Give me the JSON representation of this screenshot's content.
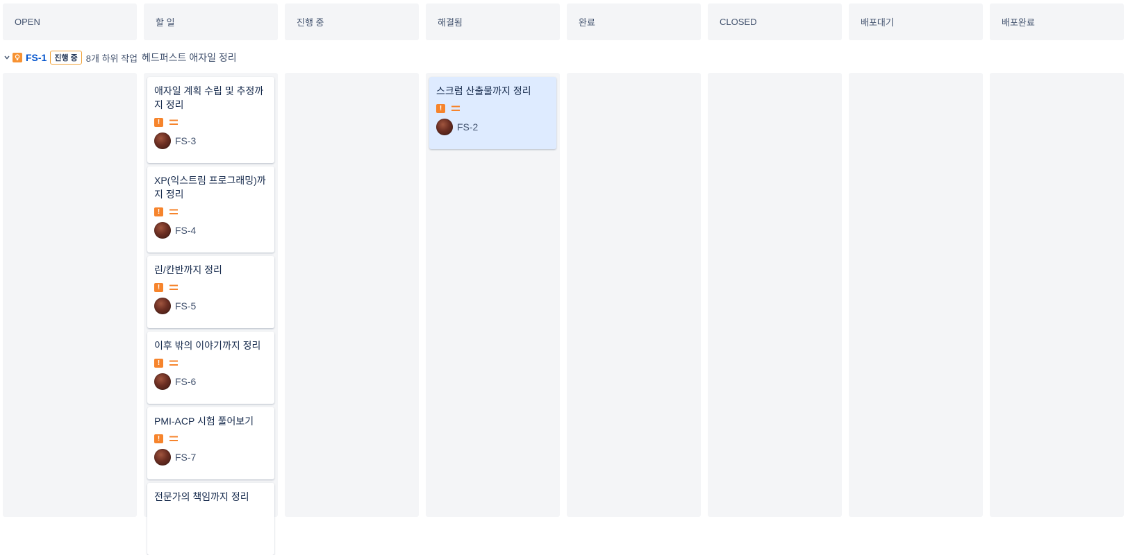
{
  "columns": [
    "OPEN",
    "할 일",
    "진행 중",
    "해결됨",
    "완료",
    "CLOSED",
    "배포대기",
    "배포완료"
  ],
  "epic": {
    "key": "FS-1",
    "status": "진행 중",
    "subtasks": "8개 하위 작업",
    "summary": "헤드퍼스트 애자일 정리",
    "icon": "lightbulb-icon",
    "color": "#f79232"
  },
  "todo_cards": [
    {
      "title": "애자일 계획 수립 및 추정까지 정리",
      "key": "FS-3",
      "priority": "major"
    },
    {
      "title": "XP(익스트림 프로그래밍)까지 정리",
      "key": "FS-4",
      "priority": "major"
    },
    {
      "title": "린/칸반까지 정리",
      "key": "FS-5",
      "priority": "major"
    },
    {
      "title": "이후 밖의 이야기까지 정리",
      "key": "FS-6",
      "priority": "major"
    },
    {
      "title": "PMI-ACP 시험 풀어보기",
      "key": "FS-7",
      "priority": "major"
    },
    {
      "title": "전문가의 책임까지 정리",
      "key": "",
      "priority": "major"
    }
  ],
  "resolved_cards": [
    {
      "title": "스크럼 산출물까지 정리",
      "key": "FS-2",
      "priority": "major"
    }
  ],
  "colors": {
    "column_bg": "#f4f5f7",
    "selected_card": "#deebff",
    "link": "#0052cc",
    "priority": "#f6842c"
  }
}
